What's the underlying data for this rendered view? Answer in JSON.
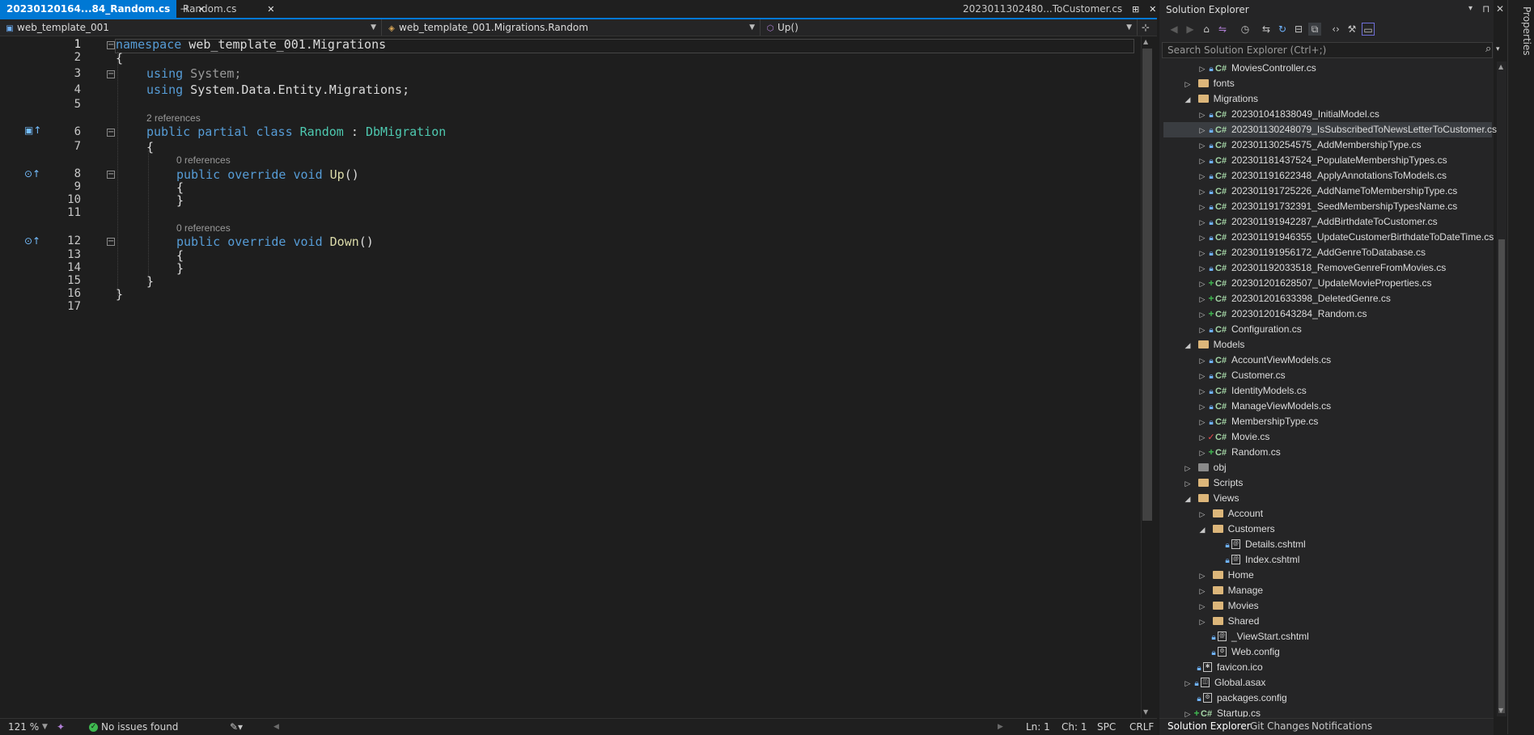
{
  "tabs": {
    "active_label": "20230120164...84_Random.cs",
    "active_pin": "⊣",
    "active_close": "✕",
    "second_label": "Random.cs",
    "second_close": "✕",
    "right_label": "2023011302480...ToCustomer.cs",
    "right_pin": "⊞",
    "right_close": "✕",
    "overflow": "▾",
    "settings": "⚙"
  },
  "navbar": {
    "project": "web_template_001",
    "type": "web_template_001.Migrations.Random",
    "member": "Up()",
    "split_button": "⊹"
  },
  "code": {
    "lines": [
      "1",
      "2",
      "3",
      "4",
      "5",
      "6",
      "7",
      "8",
      "9",
      "10",
      "11",
      "12",
      "13",
      "14",
      "15",
      "16",
      "17"
    ],
    "l1_kw": "namespace",
    "l1_name": " web_template_001.Migrations",
    "l2": "{",
    "l3_kw": "using",
    "l3_name": " System;",
    "l4_kw": "using",
    "l4_name": " System.Data.Entity.Migrations;",
    "lens_class": "2 references",
    "l6_kw": "public partial class",
    "l6_type": "Random",
    "l6_colon": " : ",
    "l6_base": "DbMigration",
    "l7": "{",
    "lens_up": "0 references",
    "l8_kw": "public override void",
    "l8_method": "Up",
    "l8_paren": "()",
    "l9": "{",
    "l10": "}",
    "lens_down": "0 references",
    "l12_kw": "public override void",
    "l12_method": "Down",
    "l12_paren": "()",
    "l13": "{",
    "l14": "}",
    "l15": "}",
    "l16": "}"
  },
  "status": {
    "zoom": "121 %",
    "issues": "No issues found",
    "ln": "Ln: 1",
    "ch": "Ch: 1",
    "spc": "SPC",
    "crlf": "CRLF"
  },
  "solution_explorer": {
    "title": "Solution Explorer",
    "search_placeholder": "Search Solution Explorer (Ctrl+;)",
    "pin": "⊓",
    "close": "✕",
    "dropdown": "▾",
    "items": [
      "MoviesController.cs",
      "fonts",
      "Migrations",
      "202301041838049_InitialModel.cs",
      "202301130248079_IsSubscribedToNewsLetterToCustomer.cs",
      "202301130254575_AddMembershipType.cs",
      "202301181437524_PopulateMembershipTypes.cs",
      "202301191622348_ApplyAnnotationsToModels.cs",
      "202301191725226_AddNameToMembershipType.cs",
      "202301191732391_SeedMembershipTypesName.cs",
      "202301191942287_AddBirthdateToCustomer.cs",
      "202301191946355_UpdateCustomerBirthdateToDateTime.cs",
      "202301191956172_AddGenreToDatabase.cs",
      "202301192033518_RemoveGenreFromMovies.cs",
      "202301201628507_UpdateMovieProperties.cs",
      "202301201633398_DeletedGenre.cs",
      "202301201643284_Random.cs",
      "Configuration.cs",
      "Models",
      "AccountViewModels.cs",
      "Customer.cs",
      "IdentityModels.cs",
      "ManageViewModels.cs",
      "MembershipType.cs",
      "Movie.cs",
      "Random.cs",
      "obj",
      "Scripts",
      "Views",
      "Account",
      "Customers",
      "Details.cshtml",
      "Index.cshtml",
      "Home",
      "Manage",
      "Movies",
      "Shared",
      "_ViewStart.cshtml",
      "Web.config",
      "favicon.ico",
      "Global.asax",
      "packages.config",
      "Startup.cs"
    ],
    "bottom_tabs": [
      "Solution Explorer",
      "Git Changes",
      "Notifications"
    ]
  },
  "properties_label": "Properties",
  "colors": {
    "accent": "#0078d4",
    "keyword": "#569cd6",
    "type": "#4ec9b0",
    "method": "#dcdcaa",
    "folder": "#dcb67a",
    "added": "#3fb950"
  }
}
